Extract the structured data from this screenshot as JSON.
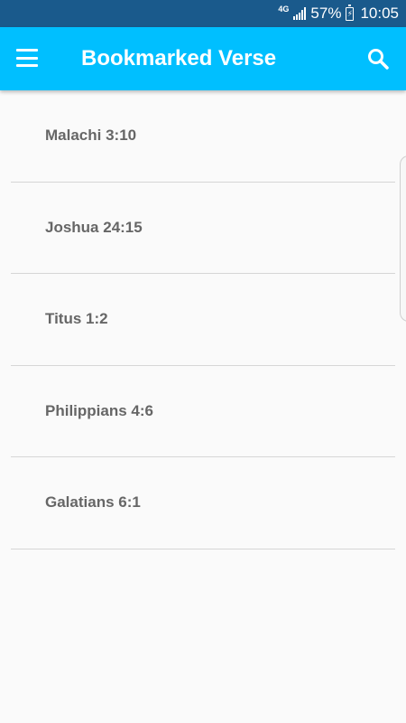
{
  "status_bar": {
    "network": "4G",
    "battery_percent": "57%",
    "battery_icon": "⚡",
    "time": "10:05"
  },
  "app_bar": {
    "title": "Bookmarked Verse",
    "menu_icon": "menu-icon",
    "search_icon": "search-icon",
    "background_color": "#00bfff"
  },
  "bookmarks": [
    {
      "reference": "Malachi 3:10"
    },
    {
      "reference": "Joshua 24:15"
    },
    {
      "reference": "Titus 1:2"
    },
    {
      "reference": "Philippians 4:6"
    },
    {
      "reference": "Galatians 6:1"
    }
  ]
}
